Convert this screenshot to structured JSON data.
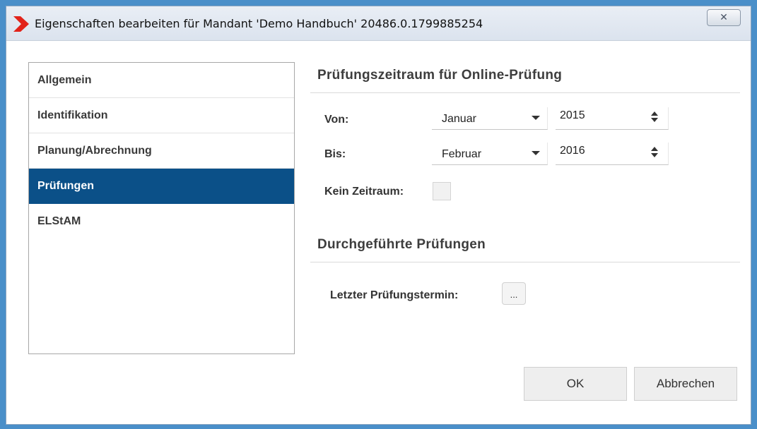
{
  "window": {
    "title": "Eigenschaften bearbeiten für Mandant 'Demo Handbuch' 20486.0.1799885254",
    "close_glyph": "✕",
    "accent_color": "#0b5088",
    "logo_color": "#e2231a"
  },
  "nav": {
    "items": [
      {
        "label": "Allgemein",
        "active": false
      },
      {
        "label": "Identifikation",
        "active": false
      },
      {
        "label": "Planung/Abrechnung",
        "active": false
      },
      {
        "label": "Prüfungen",
        "active": true
      },
      {
        "label": "ELStAM",
        "active": false
      }
    ]
  },
  "period_section": {
    "title": "Prüfungszeitraum für Online-Prüfung",
    "from_label": "Von:",
    "from_month": "Januar",
    "from_year": "2015",
    "to_label": "Bis:",
    "to_month": "Februar",
    "to_year": "2016",
    "no_period_label": "Kein Zeitraum:",
    "no_period_checked": false
  },
  "done_section": {
    "title": "Durchgeführte Prüfungen",
    "last_date_label": "Letzter Prüfungstermin:",
    "picker_label": "..."
  },
  "buttons": {
    "ok": "OK",
    "cancel": "Abbrechen"
  }
}
